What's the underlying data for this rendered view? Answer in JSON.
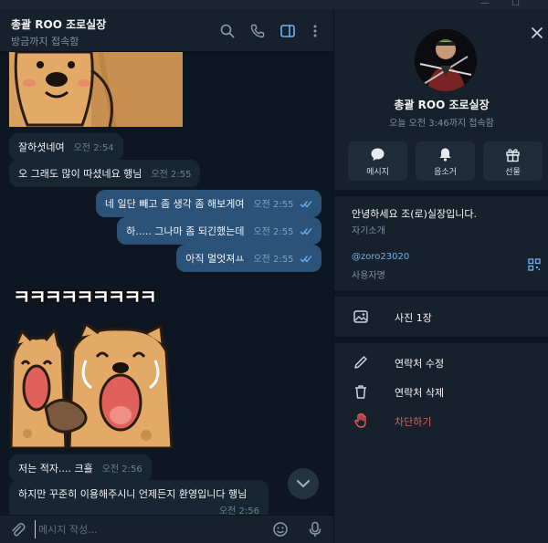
{
  "chat": {
    "title": "총괄 ROO 조로실장",
    "status": "방금까지 접속함",
    "composer_placeholder": "메시지 작성..."
  },
  "messages": [
    {
      "dir": "in",
      "text": "잘하셧네여",
      "time": "오전 2:54"
    },
    {
      "dir": "in",
      "text": "오 그래도 많이 따셨네요 행님",
      "time": "오전 2:55"
    },
    {
      "dir": "out",
      "text": "네 일단 빼고 좀 생각 좀 해보게여",
      "time": "오전 2:55"
    },
    {
      "dir": "out",
      "text": "하..... 그나마 좀 되긴했는데",
      "time": "오전 2:55"
    },
    {
      "dir": "out",
      "text": "아직 멀엇져ㅛ",
      "time": "오전 2:55"
    },
    {
      "dir": "sticker",
      "text": "ㅋㅋㅋㅋㅋㅋㅋㅋㅋ"
    },
    {
      "dir": "in",
      "text": "저는 적자.... 크흘",
      "time": "오전 2:56"
    },
    {
      "dir": "in",
      "text": "하지만 꾸준히 이용해주시니 언제든지 환영입니다 행님",
      "time": "오전 2:56"
    }
  ],
  "profile": {
    "name": "총괄 ROO 조로실장",
    "status": "오늘 오전 3:46까지 접속함",
    "actions": [
      {
        "label": "메시지",
        "icon": "message-icon"
      },
      {
        "label": "음소거",
        "icon": "bell-icon"
      },
      {
        "label": "선물",
        "icon": "gift-icon"
      }
    ],
    "bio": "안녕하세요 조(로)실장입니다.",
    "bio_caption": "자기소개",
    "username": "@zoro23020",
    "username_caption": "사용자명",
    "photos": "사진 1장",
    "edit_contact": "연락처 수정",
    "delete_contact": "연락처 삭제",
    "block": "차단하기"
  },
  "colors": {
    "accent": "#6ab3f3",
    "outgoing_bubble": "#2b5278",
    "incoming_bubble": "#182533",
    "danger": "#e85a5a"
  }
}
